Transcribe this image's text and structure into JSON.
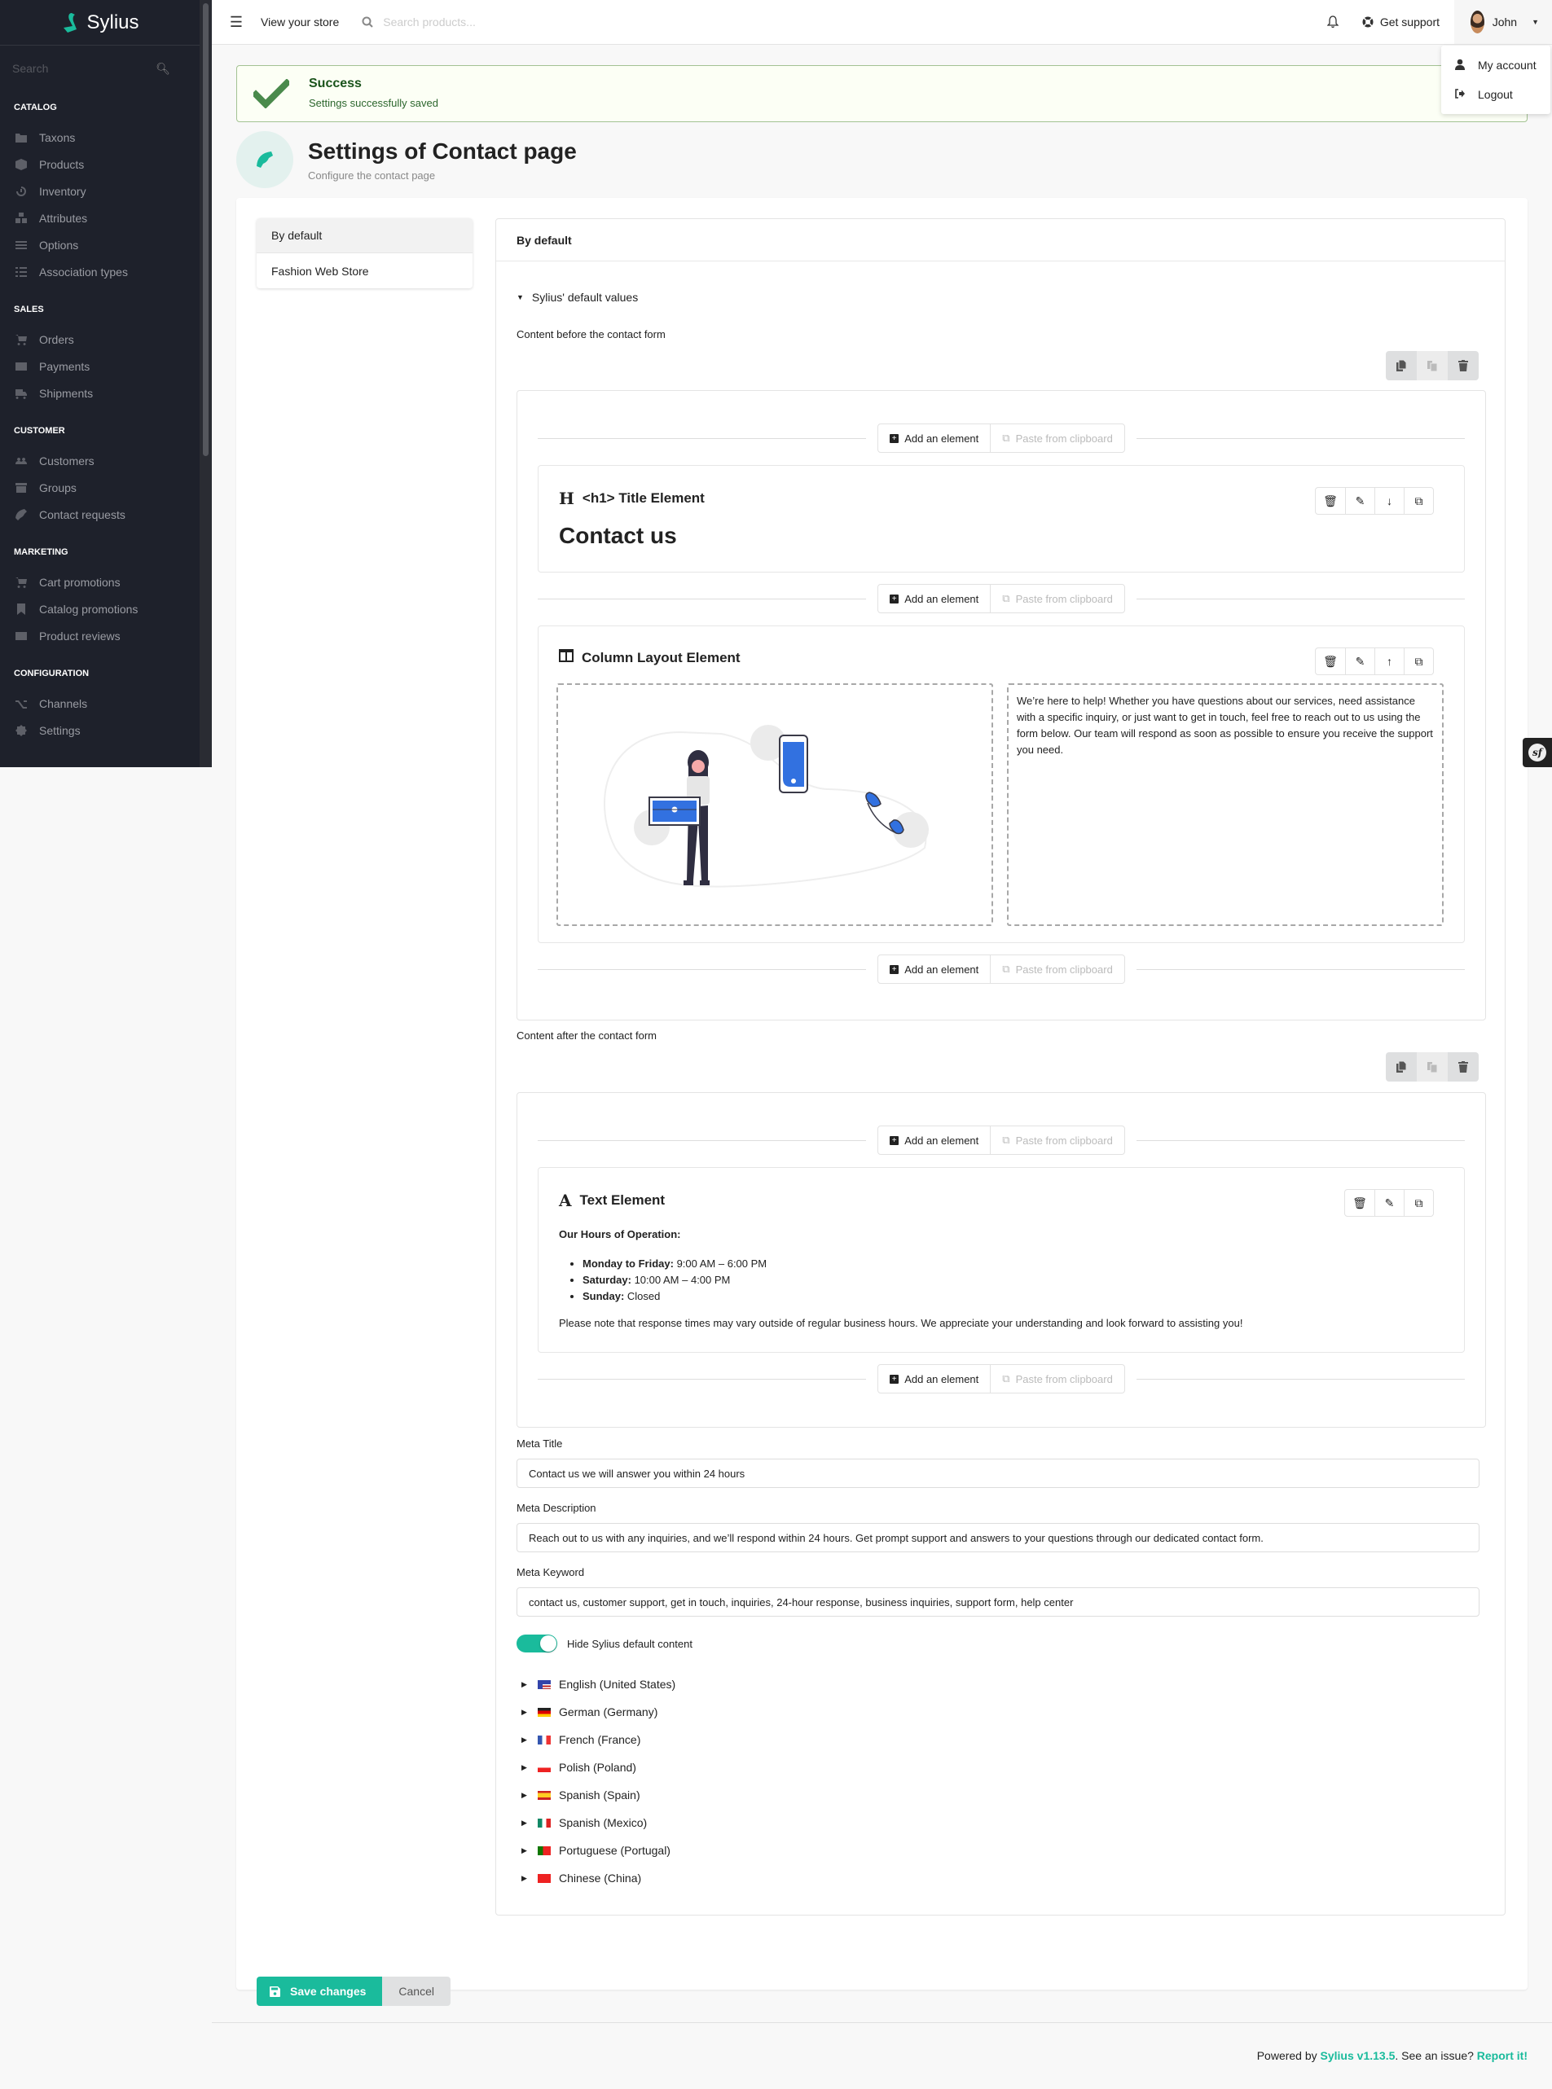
{
  "app": {
    "name": "Sylius"
  },
  "sidebar": {
    "search_placeholder": "Search",
    "sections": [
      {
        "title": "CATALOG",
        "items": [
          {
            "label": "Taxons",
            "icon": "folder-icon"
          },
          {
            "label": "Products",
            "icon": "cube-icon"
          },
          {
            "label": "Inventory",
            "icon": "history-icon"
          },
          {
            "label": "Attributes",
            "icon": "cubes-icon"
          },
          {
            "label": "Options",
            "icon": "sliders-icon"
          },
          {
            "label": "Association types",
            "icon": "tasks-icon"
          }
        ]
      },
      {
        "title": "SALES",
        "items": [
          {
            "label": "Orders",
            "icon": "cart-icon"
          },
          {
            "label": "Payments",
            "icon": "credit-card-icon"
          },
          {
            "label": "Shipments",
            "icon": "truck-icon"
          }
        ]
      },
      {
        "title": "CUSTOMER",
        "items": [
          {
            "label": "Customers",
            "icon": "users-icon"
          },
          {
            "label": "Groups",
            "icon": "archive-icon"
          },
          {
            "label": "Contact requests",
            "icon": "phone-icon"
          }
        ]
      },
      {
        "title": "MARKETING",
        "items": [
          {
            "label": "Cart promotions",
            "icon": "cart-plus-icon"
          },
          {
            "label": "Catalog promotions",
            "icon": "bookmark-icon"
          },
          {
            "label": "Product reviews",
            "icon": "newspaper-icon"
          }
        ]
      },
      {
        "title": "CONFIGURATION",
        "items": [
          {
            "label": "Channels",
            "icon": "shuffle-icon"
          },
          {
            "label": "Settings",
            "icon": "cog-icon"
          }
        ]
      }
    ]
  },
  "topbar": {
    "view_store": "View your store",
    "search_placeholder": "Search products...",
    "get_support": "Get support",
    "user_name": "John",
    "dropdown": [
      {
        "label": "My account",
        "icon": "user-icon"
      },
      {
        "label": "Logout",
        "icon": "sign-out-icon"
      }
    ]
  },
  "alert": {
    "title": "Success",
    "message": "Settings successfully saved"
  },
  "page": {
    "title": "Settings of Contact page",
    "subtitle": "Configure the contact page"
  },
  "channels": [
    {
      "label": "By default",
      "active": true
    },
    {
      "label": "Fashion Web Store",
      "active": false
    }
  ],
  "panel": {
    "header": "By default",
    "defaults_toggle": "Sylius' default values",
    "content_before_label": "Content before the contact form",
    "content_after_label": "Content after the contact form",
    "add_element": "Add an element",
    "paste_clipboard": "Paste from clipboard",
    "title_element": {
      "name": "<h1> Title Element",
      "content": "Contact us"
    },
    "column_element": {
      "name": "Column Layout Element",
      "right_text": "We’re here to help! Whether you have questions about our services, need assistance with a specific inquiry, or just want to get in touch, feel free to reach out to us using the form below. Our team will respond as soon as possible to ensure you receive the support you need."
    },
    "text_element": {
      "name": "Text Element",
      "heading": "Our Hours of Operation:",
      "hours": [
        {
          "day": "Monday to Friday:",
          "time": "9:00 AM – 6:00 PM"
        },
        {
          "day": "Saturday:",
          "time": "10:00 AM – 4:00 PM"
        },
        {
          "day": "Sunday:",
          "time": "Closed"
        }
      ],
      "note": "Please note that response times may vary outside of regular business hours. We appreciate your understanding and look forward to assisting you!"
    },
    "meta_title_label": "Meta Title",
    "meta_title_value": "Contact us we will answer you within 24 hours",
    "meta_description_label": "Meta Description",
    "meta_description_value": "Reach out to us with any inquiries, and we’ll respond within 24 hours. Get prompt support and answers to your questions through our dedicated contact form.",
    "meta_keyword_label": "Meta Keyword",
    "meta_keyword_value": "contact us, customer support, get in touch, inquiries, 24-hour response, business inquiries, support form, help center",
    "hide_default_label": "Hide Sylius default content",
    "hide_default_on": true,
    "locales": [
      {
        "label": "English (United States)",
        "flag": "us"
      },
      {
        "label": "German (Germany)",
        "flag": "de"
      },
      {
        "label": "French (France)",
        "flag": "fr"
      },
      {
        "label": "Polish (Poland)",
        "flag": "pl"
      },
      {
        "label": "Spanish (Spain)",
        "flag": "es"
      },
      {
        "label": "Spanish (Mexico)",
        "flag": "mx"
      },
      {
        "label": "Portuguese (Portugal)",
        "flag": "pt"
      },
      {
        "label": "Chinese (China)",
        "flag": "cn"
      }
    ]
  },
  "actions": {
    "save": "Save changes",
    "cancel": "Cancel"
  },
  "footer": {
    "prefix": "Powered by ",
    "version_link": "Sylius v1.13.5",
    "middle": ". See an issue? ",
    "report_link": "Report it!"
  },
  "colors": {
    "accent": "#1abb9c",
    "sidebar_bg": "#1e212b",
    "success_bg": "#fcfff5",
    "illustration_blue": "#3271e0"
  }
}
